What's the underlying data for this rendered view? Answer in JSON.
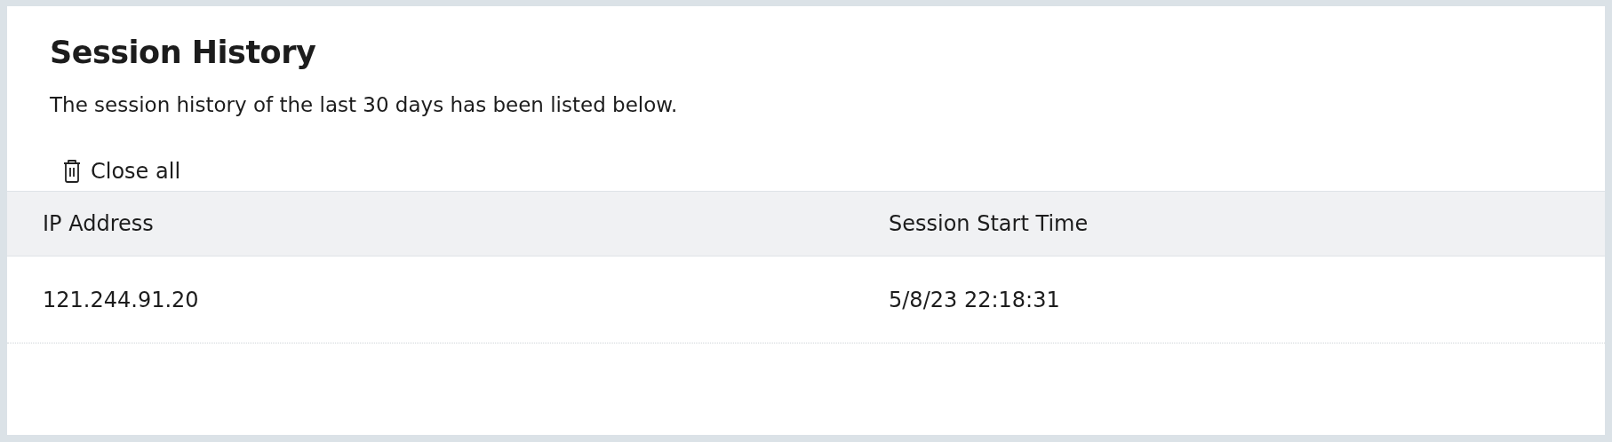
{
  "title": "Session History",
  "description": "The session history of the last 30 days has been listed below.",
  "close_all_button": {
    "label": "Close all"
  },
  "table": {
    "columns": [
      "IP Address",
      "Session Start Time"
    ],
    "rows": [
      [
        "121.244.91.20",
        "5/8/23 22:18:31"
      ]
    ]
  }
}
